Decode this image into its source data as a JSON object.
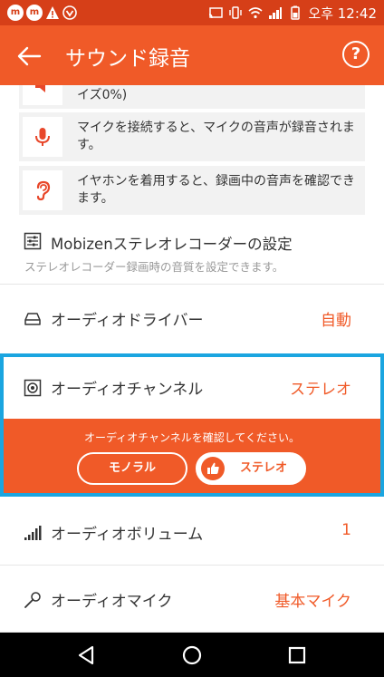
{
  "status_bar": {
    "time": "오후 12:42",
    "left_icons": [
      "mobizen-icon",
      "mobizen-icon",
      "alert-icon",
      "download-icon"
    ],
    "right_icons": [
      "screen-cast-icon",
      "vibrate-icon",
      "wifi-icon",
      "signal-icon",
      "battery-icon"
    ]
  },
  "app_bar": {
    "title": "サウンド録音",
    "back_icon": "arrow-left-icon",
    "help_label": "?"
  },
  "info_cards": [
    {
      "icon": "speaker-icon",
      "text": "イズ0%)"
    },
    {
      "icon": "microphone-icon",
      "text": "マイクを接続すると、マイクの音声が録音されます。"
    },
    {
      "icon": "ear-icon",
      "text": "イヤホンを着用すると、録画中の音声を確認できます。"
    }
  ],
  "stereo_recorder": {
    "title": "Mobizenステレオレコーダーの設定",
    "subtitle": "ステレオレコーダー録画時の音質を設定できます。"
  },
  "settings": {
    "audio_driver": {
      "label": "オーディオドライバー",
      "value": "自動"
    },
    "audio_channel": {
      "label": "オーディオチャンネル",
      "value": "ステレオ",
      "prompt": "オーディオチャンネルを確認してください。",
      "options": [
        "モノラル",
        "ステレオ"
      ],
      "selected": "ステレオ"
    },
    "audio_volume": {
      "label": "オーディオボリューム",
      "value": "1"
    },
    "audio_mic": {
      "label": "オーディオマイク",
      "value": "基本マイク"
    }
  },
  "colors": {
    "accent": "#f05a28",
    "status_bar": "#d63f18",
    "highlight_border": "#1aa5e0",
    "icon_red": "#e8472a"
  },
  "nav_bar": {
    "buttons": [
      "back-triangle-icon",
      "home-circle-icon",
      "recents-square-icon"
    ]
  }
}
